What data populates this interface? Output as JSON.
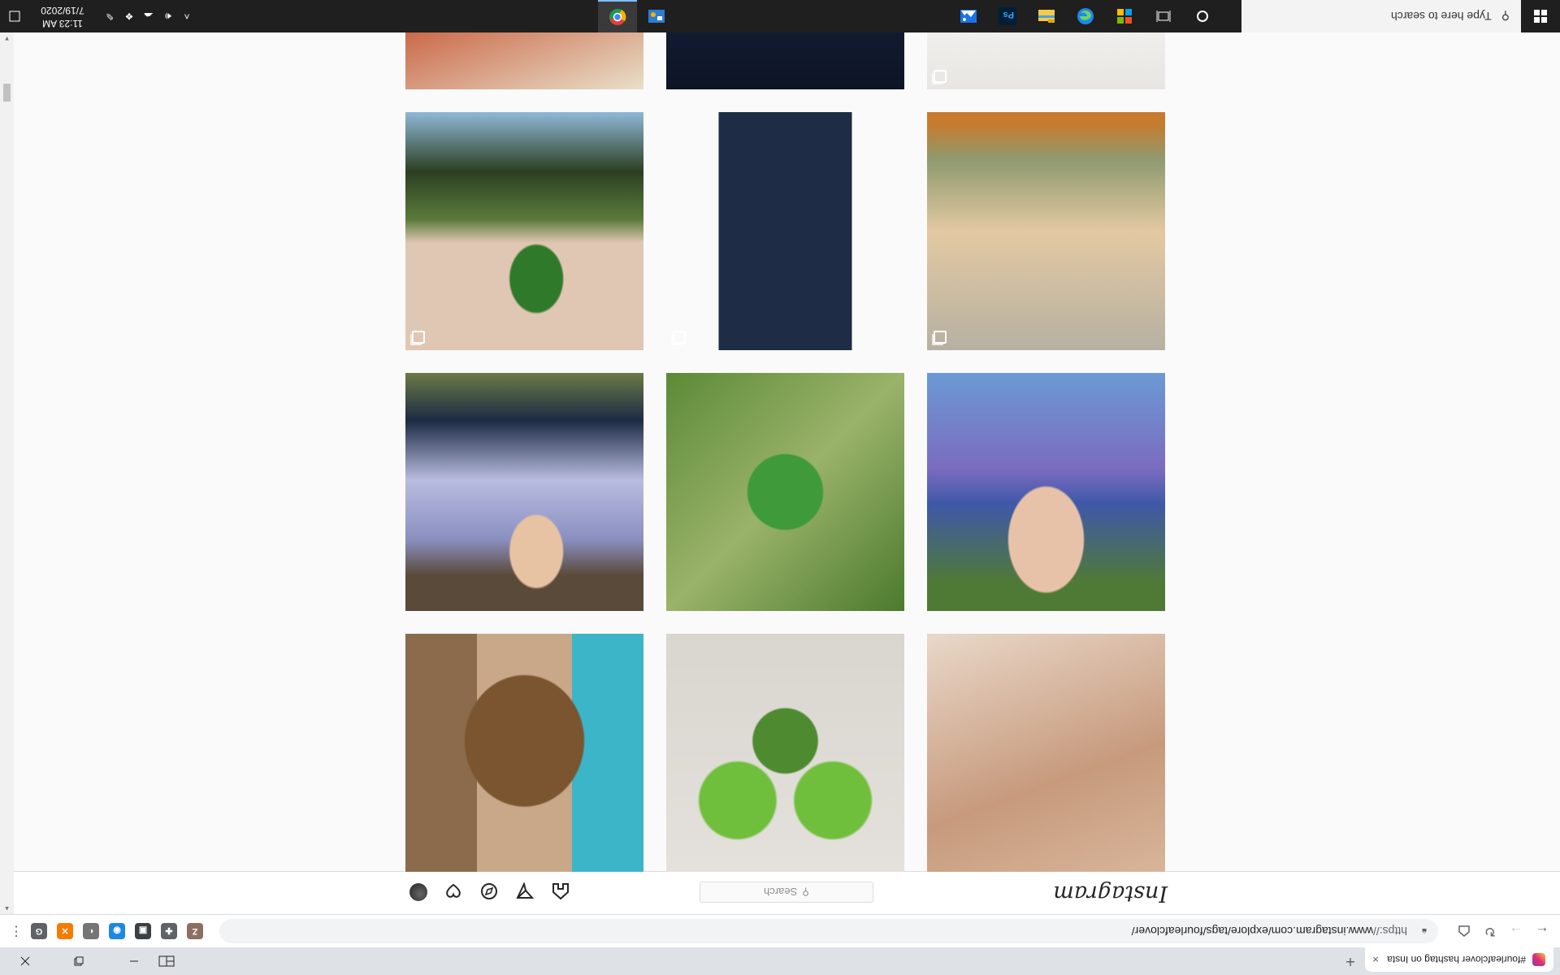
{
  "browser": {
    "tab_title": "#fourleafclover hashtag on Insta",
    "tab_close": "×",
    "new_tab": "+",
    "url_scheme": "https://",
    "url_rest": "www.instagram.com/explore/tags/fourleafclover/"
  },
  "instagram": {
    "logo": "Instagram",
    "search_placeholder": "Search"
  },
  "taskbar": {
    "search_placeholder": "Type here to search",
    "time": "11:23 AM",
    "date": "7/19/2020"
  },
  "extensions": [
    {
      "letter": "Z",
      "color": "#8d6e63"
    },
    {
      "letter": "✚",
      "color": "#5f6368"
    },
    {
      "letter": "▣",
      "color": "#3c4043"
    },
    {
      "letter": "◉",
      "color": "#1e88e5"
    },
    {
      "letter": "◐",
      "color": "#757575"
    },
    {
      "letter": "✕",
      "color": "#f57c00"
    },
    {
      "letter": "G",
      "color": "#5f6368"
    }
  ],
  "grid_items": [
    {
      "name": "post-clover-hand",
      "bg": "linear-gradient(160deg,#d8b59a,#c79a7d 40%,#e9d8c9)",
      "multi": false
    },
    {
      "name": "post-macrame-necklace",
      "bg": "radial-gradient(circle at 50% 55%,#4e8a2f 0 18%,transparent 19%),radial-gradient(circle at 30% 30%,#6fbf3c 0 16%,transparent 17%),radial-gradient(circle at 70% 30%,#6fbf3c 0 16%,transparent 17%),linear-gradient(#e4e1dc,#d9d5cf)",
      "multi": false
    },
    {
      "name": "post-curly-hair",
      "bg": "radial-gradient(ellipse at 50% 55%,#7a5530 0 35%,transparent 36%),linear-gradient(90deg,#3cb5c9 0 30%,#c9a88a 30% 70%,#8b6b4c 70%)",
      "multi": false
    },
    {
      "name": "post-girl-tie-dye",
      "bg": "radial-gradient(ellipse at 50% 30%,#e8c2a8 0 22%,transparent 23%),linear-gradient(#4f7a36 0 12%,#3f58a8 45%,#7b6cc0 60%,#6b9ad4)",
      "multi": false
    },
    {
      "name": "post-four-leaf-closeup",
      "bg": "radial-gradient(circle at 50% 50%,#3f9a3a 0 22%,transparent 23%),linear-gradient(135deg,#4b7a2e,#9ab36a 50%,#5c8a37)",
      "multi": false
    },
    {
      "name": "post-boy-striped-shirt",
      "bg": "radial-gradient(ellipse at 45% 25%,#e7c3a3 0 14%,transparent 15%),linear-gradient(#5a4a3a 0 15%,#8a8fc0 30%,#b9bce0 55%,#1c2a44 80%,#6b7a45)",
      "multi": false
    },
    {
      "name": "post-sky-reflection",
      "bg": "linear-gradient(#b7b0a2,#e3c9a2 50%,#8f9a70 80%,#c77b2e 95%)",
      "multi": true
    },
    {
      "name": "post-tiktok-video",
      "bg": "linear-gradient(90deg,#fafafa 0 22%,#1f2c45 22% 78%,#fafafa 78%),radial-gradient(ellipse at 50% 40%,#e7a48b 0 12%,transparent 13%)",
      "multi": true
    },
    {
      "name": "post-clovers-pond",
      "bg": "radial-gradient(ellipse at 45% 30%,#2f7a2a 0 14%,transparent 15%),linear-gradient(#e0c7b3 0 45%,#5a7a3a 55%,#2c3f22 75%,#8fb8d8)",
      "multi": true
    },
    {
      "name": "post-white-shirt",
      "bg": "linear-gradient(#e8e6e2,#f4f4f2 40%,#5d7e3f)",
      "multi": true
    },
    {
      "name": "post-bowl-dark",
      "bg": "linear-gradient(#0d1426,#17213a 50%,#f2ece2 80%,#1a1a1a)",
      "multi": false
    },
    {
      "name": "post-clover-candle",
      "bg": "linear-gradient(160deg,#e9dfc9,#c75a3a 50%,#3d7a2a)",
      "multi": false
    }
  ]
}
